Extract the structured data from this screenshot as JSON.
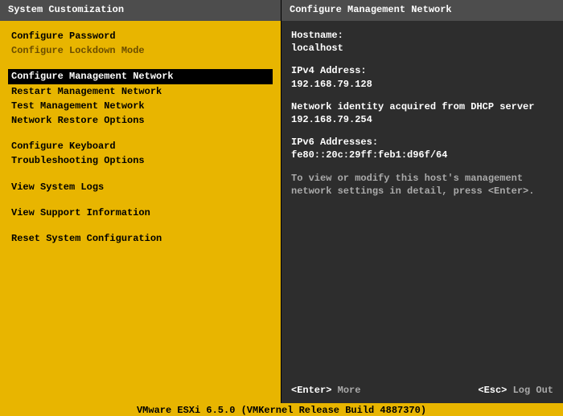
{
  "left": {
    "title": "System Customization",
    "groups": [
      [
        {
          "label": "Configure Password",
          "selected": false,
          "dim": false
        },
        {
          "label": "Configure Lockdown Mode",
          "selected": false,
          "dim": true
        }
      ],
      [
        {
          "label": "Configure Management Network",
          "selected": true,
          "dim": false
        },
        {
          "label": "Restart Management Network",
          "selected": false,
          "dim": false
        },
        {
          "label": "Test Management Network",
          "selected": false,
          "dim": false
        },
        {
          "label": "Network Restore Options",
          "selected": false,
          "dim": false
        }
      ],
      [
        {
          "label": "Configure Keyboard",
          "selected": false,
          "dim": false
        },
        {
          "label": "Troubleshooting Options",
          "selected": false,
          "dim": false
        }
      ],
      [
        {
          "label": "View System Logs",
          "selected": false,
          "dim": false
        }
      ],
      [
        {
          "label": "View Support Information",
          "selected": false,
          "dim": false
        }
      ],
      [
        {
          "label": "Reset System Configuration",
          "selected": false,
          "dim": false
        }
      ]
    ]
  },
  "right": {
    "title": "Configure Management Network",
    "hostname_label": "Hostname:",
    "hostname_value": "localhost",
    "ipv4_label": "IPv4 Address:",
    "ipv4_value": "192.168.79.128",
    "dhcp_line": "Network identity acquired from DHCP server 192.168.79.254",
    "ipv6_label": "IPv6 Addresses:",
    "ipv6_value": "fe80::20c:29ff:feb1:d96f/64",
    "hint": "To view or modify this host's management network settings in detail, press <Enter>.",
    "footer": {
      "enter_key": "<Enter>",
      "enter_label": " More",
      "esc_key": "<Esc>",
      "esc_label": " Log Out"
    }
  },
  "bottom": {
    "text": "VMware ESXi 6.5.0 (VMKernel Release Build 4887370)"
  }
}
